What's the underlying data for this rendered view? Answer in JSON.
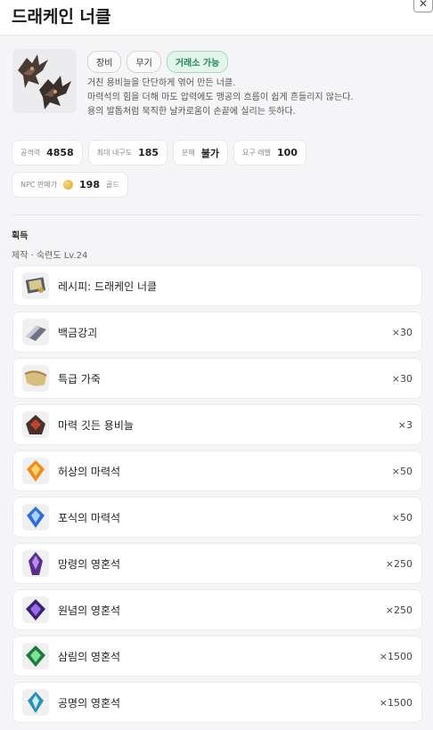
{
  "window": {
    "title": "드래케인 너클",
    "close_label": "✕"
  },
  "item": {
    "badges": {
      "type": "장비",
      "category": "무기",
      "trade": "거래소 가능"
    },
    "desc_lines": [
      "거친 용비늘을 단단하게 엮어 만든 너클.",
      "마력석의 힘을 더해 마도 압력에도 맹공의 흐름이 쉽게 흔들리지 않는다.",
      "용의 발톱처럼 묵직한 날카로움이 손끝에 실리는 듯하다."
    ]
  },
  "stats": [
    {
      "label": "공격력",
      "value": "4858"
    },
    {
      "label": "최대 내구도",
      "value": "185"
    },
    {
      "label": "분해",
      "value": "불가"
    },
    {
      "label": "요구 레벨",
      "value": "100"
    }
  ],
  "price": {
    "label": "NPC 판매가",
    "value": "198",
    "unit": "골드"
  },
  "acquire": {
    "title": "획득",
    "subtitle": "제작 · 숙련도 Lv.24",
    "recipe": {
      "name": "레시피: 드래케인 너클",
      "icon": "recipe-scroll-icon"
    },
    "materials": [
      {
        "name": "백금강괴",
        "qty": "×30",
        "icon": "platinum-ingot-icon"
      },
      {
        "name": "특급 가죽",
        "qty": "×30",
        "icon": "leather-icon"
      },
      {
        "name": "마력 깃든 용비늘",
        "qty": "×3",
        "icon": "dragon-scale-icon"
      },
      {
        "name": "허상의 마력석",
        "qty": "×50",
        "icon": "orange-crystal-icon"
      },
      {
        "name": "포식의 마력석",
        "qty": "×50",
        "icon": "blue-crystal-icon"
      },
      {
        "name": "망령의 영혼석",
        "qty": "×250",
        "icon": "purple-soulstone-icon"
      },
      {
        "name": "원념의 영혼석",
        "qty": "×250",
        "icon": "violet-soulstone-icon"
      },
      {
        "name": "삼림의 영혼석",
        "qty": "×1500",
        "icon": "green-soulstone-icon"
      },
      {
        "name": "공명의 영혼석",
        "qty": "×1500",
        "icon": "cyan-soulstone-icon"
      }
    ]
  }
}
